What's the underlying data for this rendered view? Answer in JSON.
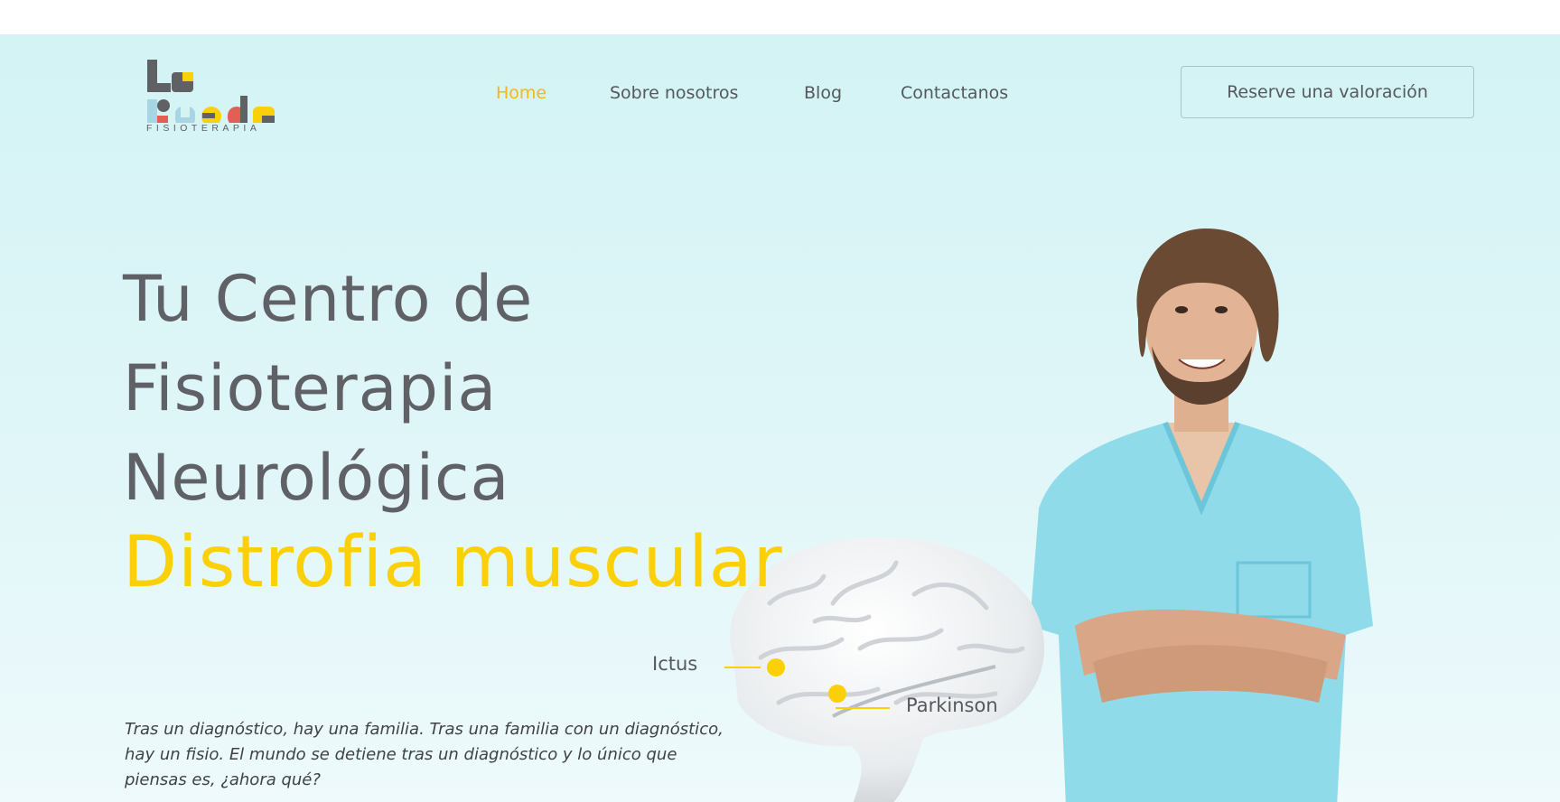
{
  "logo": {
    "wordmark": "FISIOTERAPIA",
    "icon": "la-rueda-logo"
  },
  "nav": {
    "items": [
      {
        "label": "Home",
        "active": true
      },
      {
        "label": "Sobre nosotros",
        "active": false
      },
      {
        "label": "Blog",
        "active": false
      },
      {
        "label": "Contactanos",
        "active": false
      }
    ],
    "cta_label": "Reserve una valoración"
  },
  "hero": {
    "heading_lines": [
      "Tu Centro de",
      "Fisioterapia",
      "Neurológica"
    ],
    "rotating_word": "Distrofia muscular",
    "labels": {
      "ictus": "Ictus",
      "parkinson": "Parkinson"
    },
    "tagline": "Tras un diagnóstico, hay una familia. Tras una familia con un diagnóstico, hay un fisio. El mundo se detiene tras un diagnóstico y lo único que piensas es, ¿ahora qué?"
  },
  "icons": {
    "scroll_top": "chevron-up-icon",
    "brain": "brain-illustration",
    "person": "physiotherapist-photo"
  },
  "colors": {
    "accent": "#fcd007",
    "nav_active": "#f6b818",
    "text": "#606166",
    "hero_bg": "#d3f3f5",
    "scrub": "#8fdbea"
  }
}
